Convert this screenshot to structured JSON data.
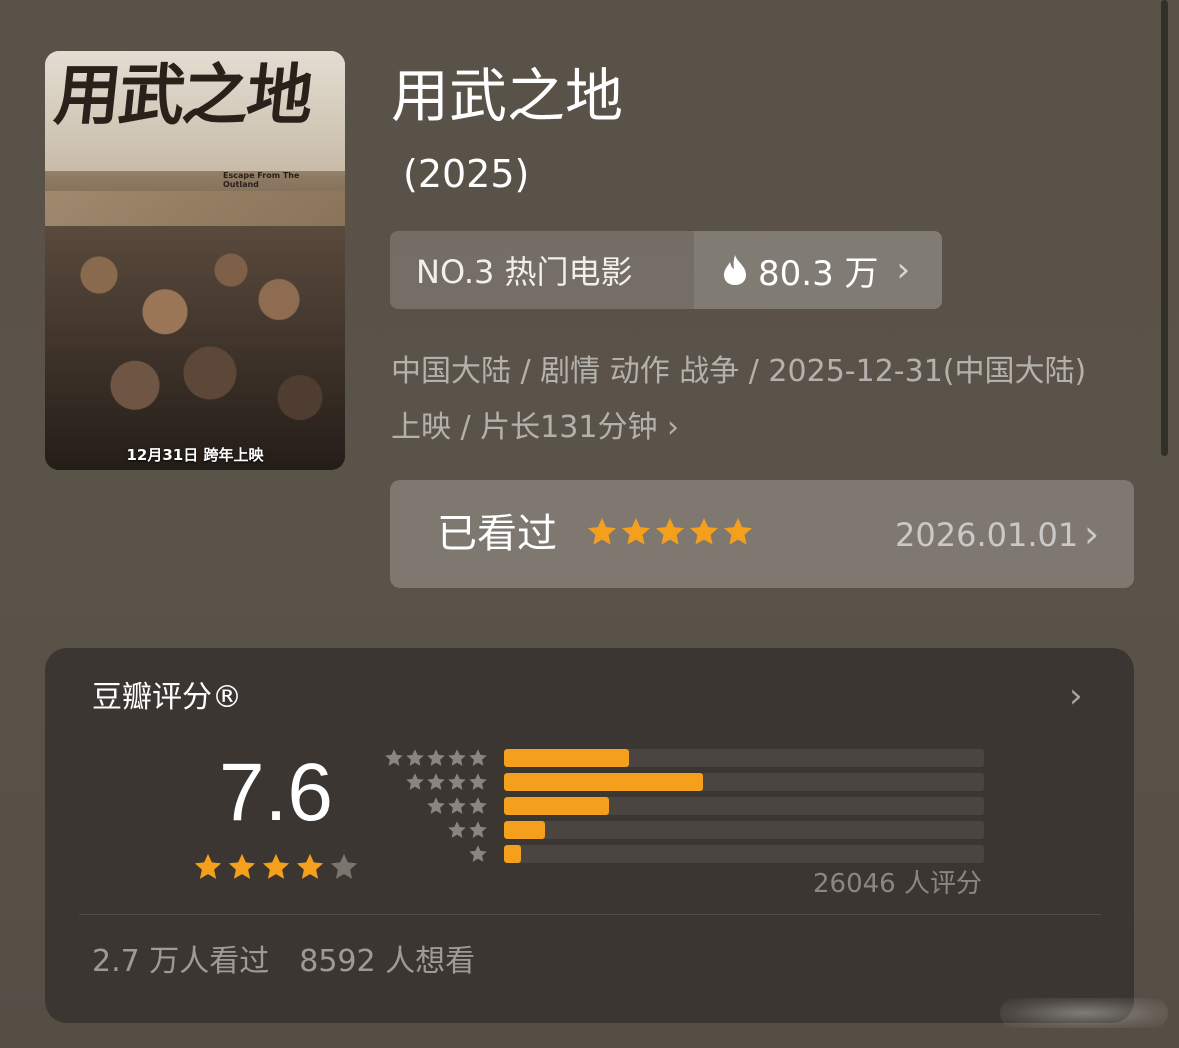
{
  "poster": {
    "title_art": "用武之地",
    "subtitle_art": "Escape From The Outland",
    "release_note": "12月31日 跨年上映"
  },
  "movie": {
    "title": "用武之地",
    "year": "(2025)"
  },
  "rank": {
    "label": "NO.3 热门电影",
    "heat": "80.3 万",
    "icon": "fire-icon"
  },
  "meta": {
    "text": "中国大陆 / 剧情 动作 战争 / 2025-12-31(中国大陆) 上映 / 片长131分钟"
  },
  "watched": {
    "label": "已看过",
    "stars": 5,
    "date": "2026.01.01"
  },
  "rating": {
    "heading": "豆瓣评分®",
    "score": "7.6",
    "score_stars": 4,
    "distribution": [
      {
        "stars": 5,
        "fraction": 0.26
      },
      {
        "stars": 4,
        "fraction": 0.415
      },
      {
        "stars": 3,
        "fraction": 0.218
      },
      {
        "stars": 2,
        "fraction": 0.085
      },
      {
        "stars": 1,
        "fraction": 0.035
      }
    ],
    "total": "26046 人评分",
    "watched_count": "2.7 万人看过",
    "want_count": "8592 人想看"
  },
  "colors": {
    "accent_star": "#f5a01c",
    "empty_star": "#7a756f",
    "card_bg": "#3b3631"
  }
}
